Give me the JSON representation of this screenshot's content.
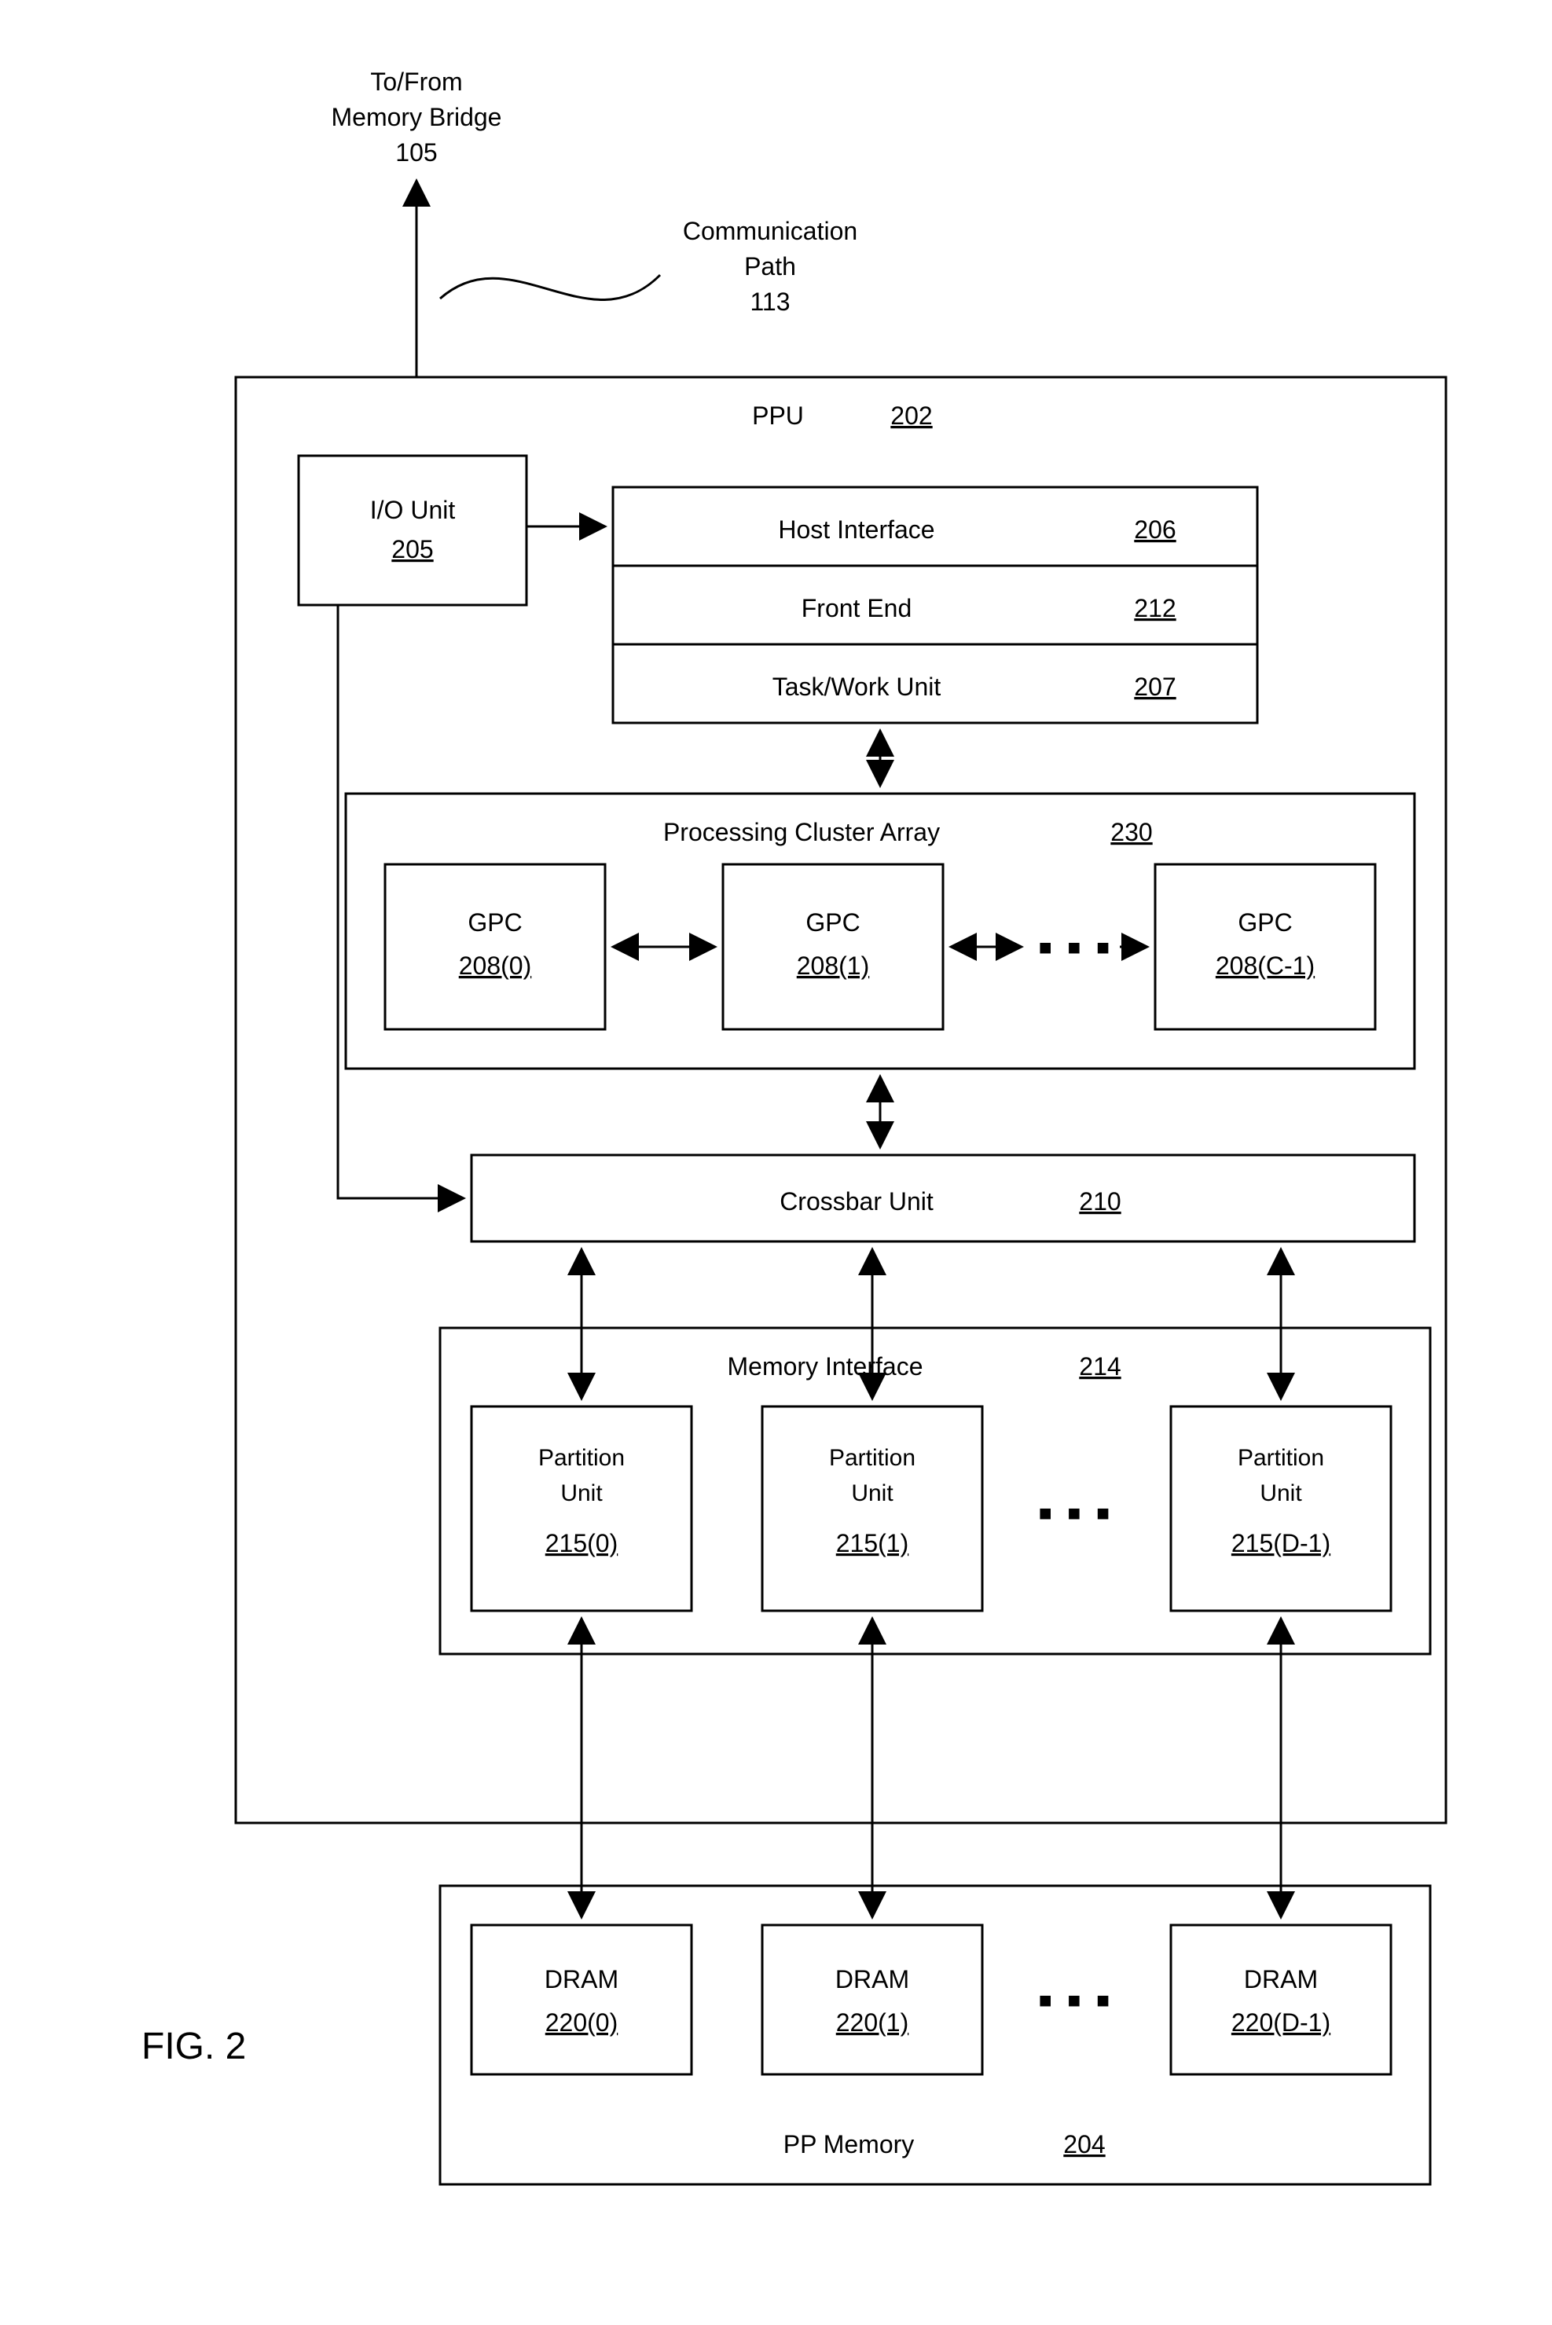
{
  "figure_label": "FIG. 2",
  "external": {
    "bridge_line1": "To/From",
    "bridge_line2": "Memory Bridge",
    "bridge_ref": "105",
    "comm_line1": "Communication",
    "comm_line2": "Path",
    "comm_ref": "113"
  },
  "ppu": {
    "title": "PPU",
    "ref": "202",
    "io": {
      "label": "I/O Unit",
      "ref": "205"
    },
    "host": {
      "label": "Host Interface",
      "ref": "206"
    },
    "fe": {
      "label": "Front End",
      "ref": "212"
    },
    "twu": {
      "label": "Task/Work Unit",
      "ref": "207"
    },
    "pca": {
      "title": "Processing Cluster Array",
      "ref": "230",
      "gpc": {
        "label": "GPC",
        "refs": [
          "208(0)",
          "208(1)",
          "208(C-1)"
        ]
      }
    },
    "xbar": {
      "label": "Crossbar Unit",
      "ref": "210"
    },
    "mi": {
      "title": "Memory Interface",
      "ref": "214",
      "pu": {
        "label1": "Partition",
        "label2": "Unit",
        "refs": [
          "215(0)",
          "215(1)",
          "215(D-1)"
        ]
      }
    }
  },
  "ppmem": {
    "title": "PP Memory",
    "ref": "204",
    "dram": {
      "label": "DRAM",
      "refs": [
        "220(0)",
        "220(1)",
        "220(D-1)"
      ]
    }
  },
  "dots": "■ ■ ■"
}
